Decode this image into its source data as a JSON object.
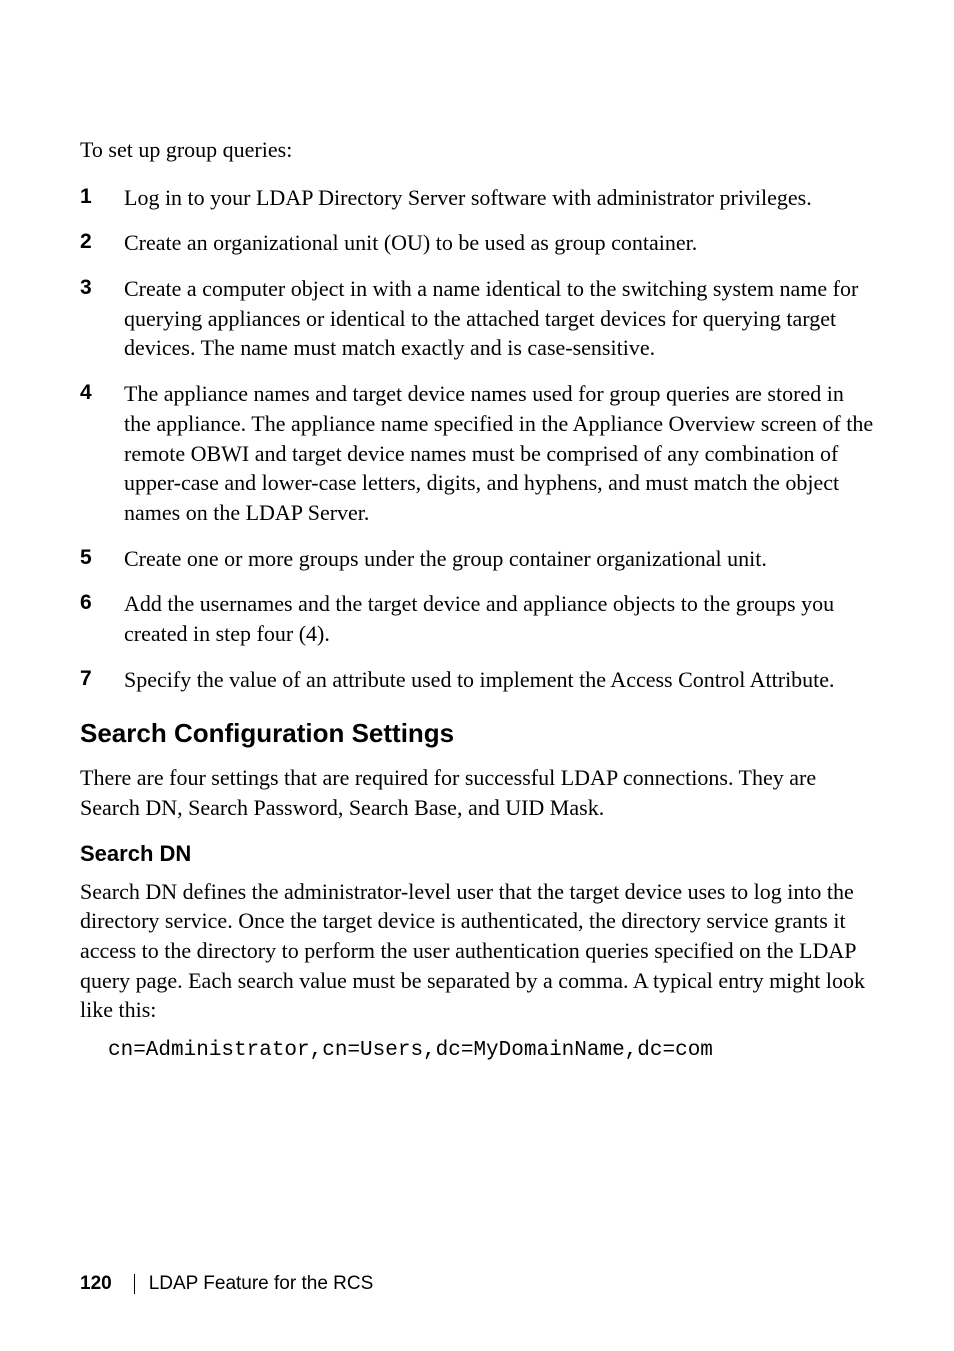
{
  "intro": "To set up group queries:",
  "steps": [
    "Log in to your LDAP Directory Server software with administrator privileges.",
    "Create an organizational unit (OU) to be used as group container.",
    "Create a computer object in with a name identical to the switching system name for querying appliances or identical to the attached target devices for querying target devices. The name must match exactly and is case-sensitive.",
    "The appliance names and target device names used for group queries are stored in the appliance. The appliance name specified in the Appliance Overview screen of the remote OBWI and target device names must be comprised of any combination of upper-case and lower-case letters, digits, and hyphens, and must match the object names on the LDAP Server.",
    "Create one or more groups under the group container organizational unit.",
    "Add the usernames and the target device and appliance objects to the groups you created in step four (4).",
    "Specify the value of an attribute used to implement the Access Control Attribute."
  ],
  "section_heading": "Search Configuration Settings",
  "section_body": "There are four settings that are required for successful LDAP connections. They are Search DN, Search Password, Search Base, and UID Mask.",
  "subheading": "Search DN",
  "subbody": "Search DN defines the administrator-level user that the target device uses to log into the directory service. Once the target device is authenticated, the directory service grants it access to the directory to perform the user authentication queries specified on the LDAP query page. Each search value must be separated by a comma. A typical entry might look like this:",
  "code": "cn=Administrator,cn=Users,dc=MyDomainName,dc=com",
  "footer": {
    "page": "120",
    "title": "LDAP Feature for the RCS"
  }
}
